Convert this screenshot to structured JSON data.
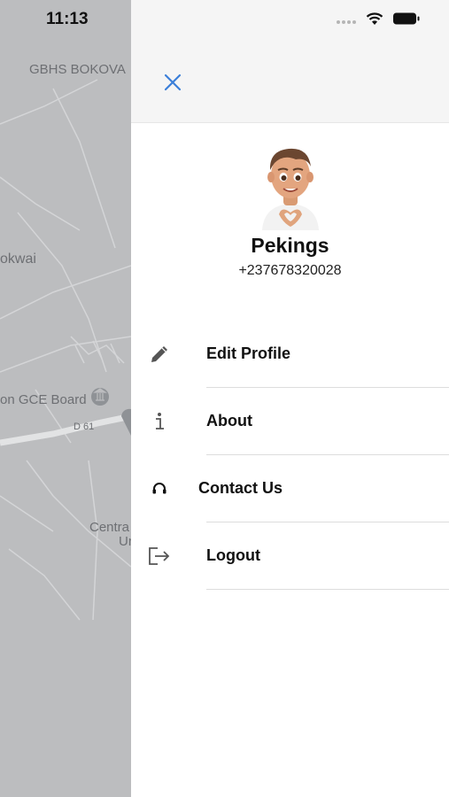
{
  "status_bar": {
    "time": "11:13"
  },
  "map": {
    "labels": [
      "GBHS BOKOVA",
      "okwai",
      "on GCE Board",
      "D 61",
      "Centra",
      "Ur"
    ]
  },
  "drawer": {
    "close_icon": "close-icon",
    "profile": {
      "name": "Pekings",
      "phone": "+237678320028"
    },
    "menu": [
      {
        "label": "Edit Profile",
        "icon": "pencil-icon"
      },
      {
        "label": "About",
        "icon": "info-icon"
      },
      {
        "label": "Contact Us",
        "icon": "headset-icon"
      },
      {
        "label": "Logout",
        "icon": "logout-icon"
      }
    ]
  },
  "colors": {
    "accent": "#3b7fd9",
    "map_bg": "#bcbdbf",
    "header_bg": "#f5f5f5"
  }
}
